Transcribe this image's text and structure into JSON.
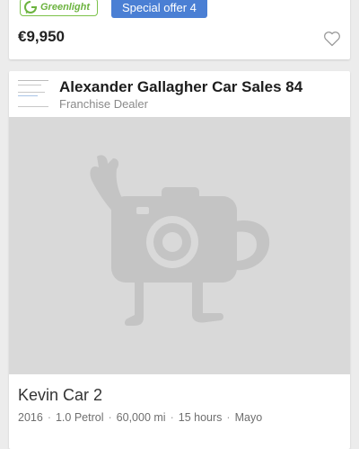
{
  "listing_prev": {
    "greenlight_label": "Greenlight",
    "offer_badge": "Special offer 4",
    "price": "€9,950",
    "favorite_icon": "heart-outline-icon"
  },
  "listing": {
    "dealer_name": "Alexander Gallagher Car Sales 84",
    "dealer_type": "Franchise Dealer",
    "photo_placeholder_icon": "camera-mascot-icon",
    "title": "Kevin Car 2",
    "meta": [
      "2016",
      "1.0 Petrol",
      "60,000 mi",
      "15 hours",
      "Mayo"
    ]
  },
  "colors": {
    "offer_badge": "#4a7fd4",
    "greenlight": "#6cb33f",
    "photo_bg": "#d9d9d9"
  }
}
